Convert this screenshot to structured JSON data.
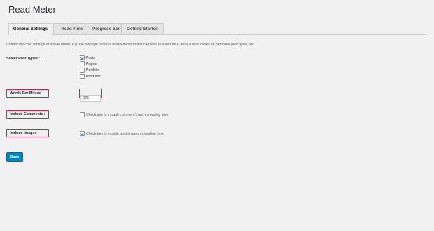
{
  "page": {
    "title": "Read Meter"
  },
  "tabs": [
    {
      "label": "General Settings",
      "active": true
    },
    {
      "label": "Read Time",
      "active": false
    },
    {
      "label": "Progress Bar",
      "active": false
    },
    {
      "label": "Getting Started",
      "active": false
    }
  ],
  "description": "Control the core settings of a read meter, e.g. the average count of words that humans can read in a minute & allow a read meter on particular post types, etc.",
  "post_types": {
    "label": "Select Post Types :",
    "options": [
      {
        "label": "Posts",
        "checked": true
      },
      {
        "label": "Pages",
        "checked": false
      },
      {
        "label": "Portfolio",
        "checked": false
      },
      {
        "label": "Products",
        "checked": false
      }
    ]
  },
  "words_per_minute": {
    "label": "Words Per Minute :",
    "value": "275"
  },
  "include_comments": {
    "label": "Include Comments :",
    "checkbox_text": "Check this to include comment's text in reading time.",
    "checked": false
  },
  "include_images": {
    "label": "Include Images :",
    "checkbox_text": "Check this to include post images in reading time.",
    "checked": true
  },
  "save_button": {
    "label": "Save"
  },
  "colors": {
    "highlight_border": "#d6204b",
    "button_bg": "#0085ba",
    "checkmark": "#1e8cbe"
  }
}
